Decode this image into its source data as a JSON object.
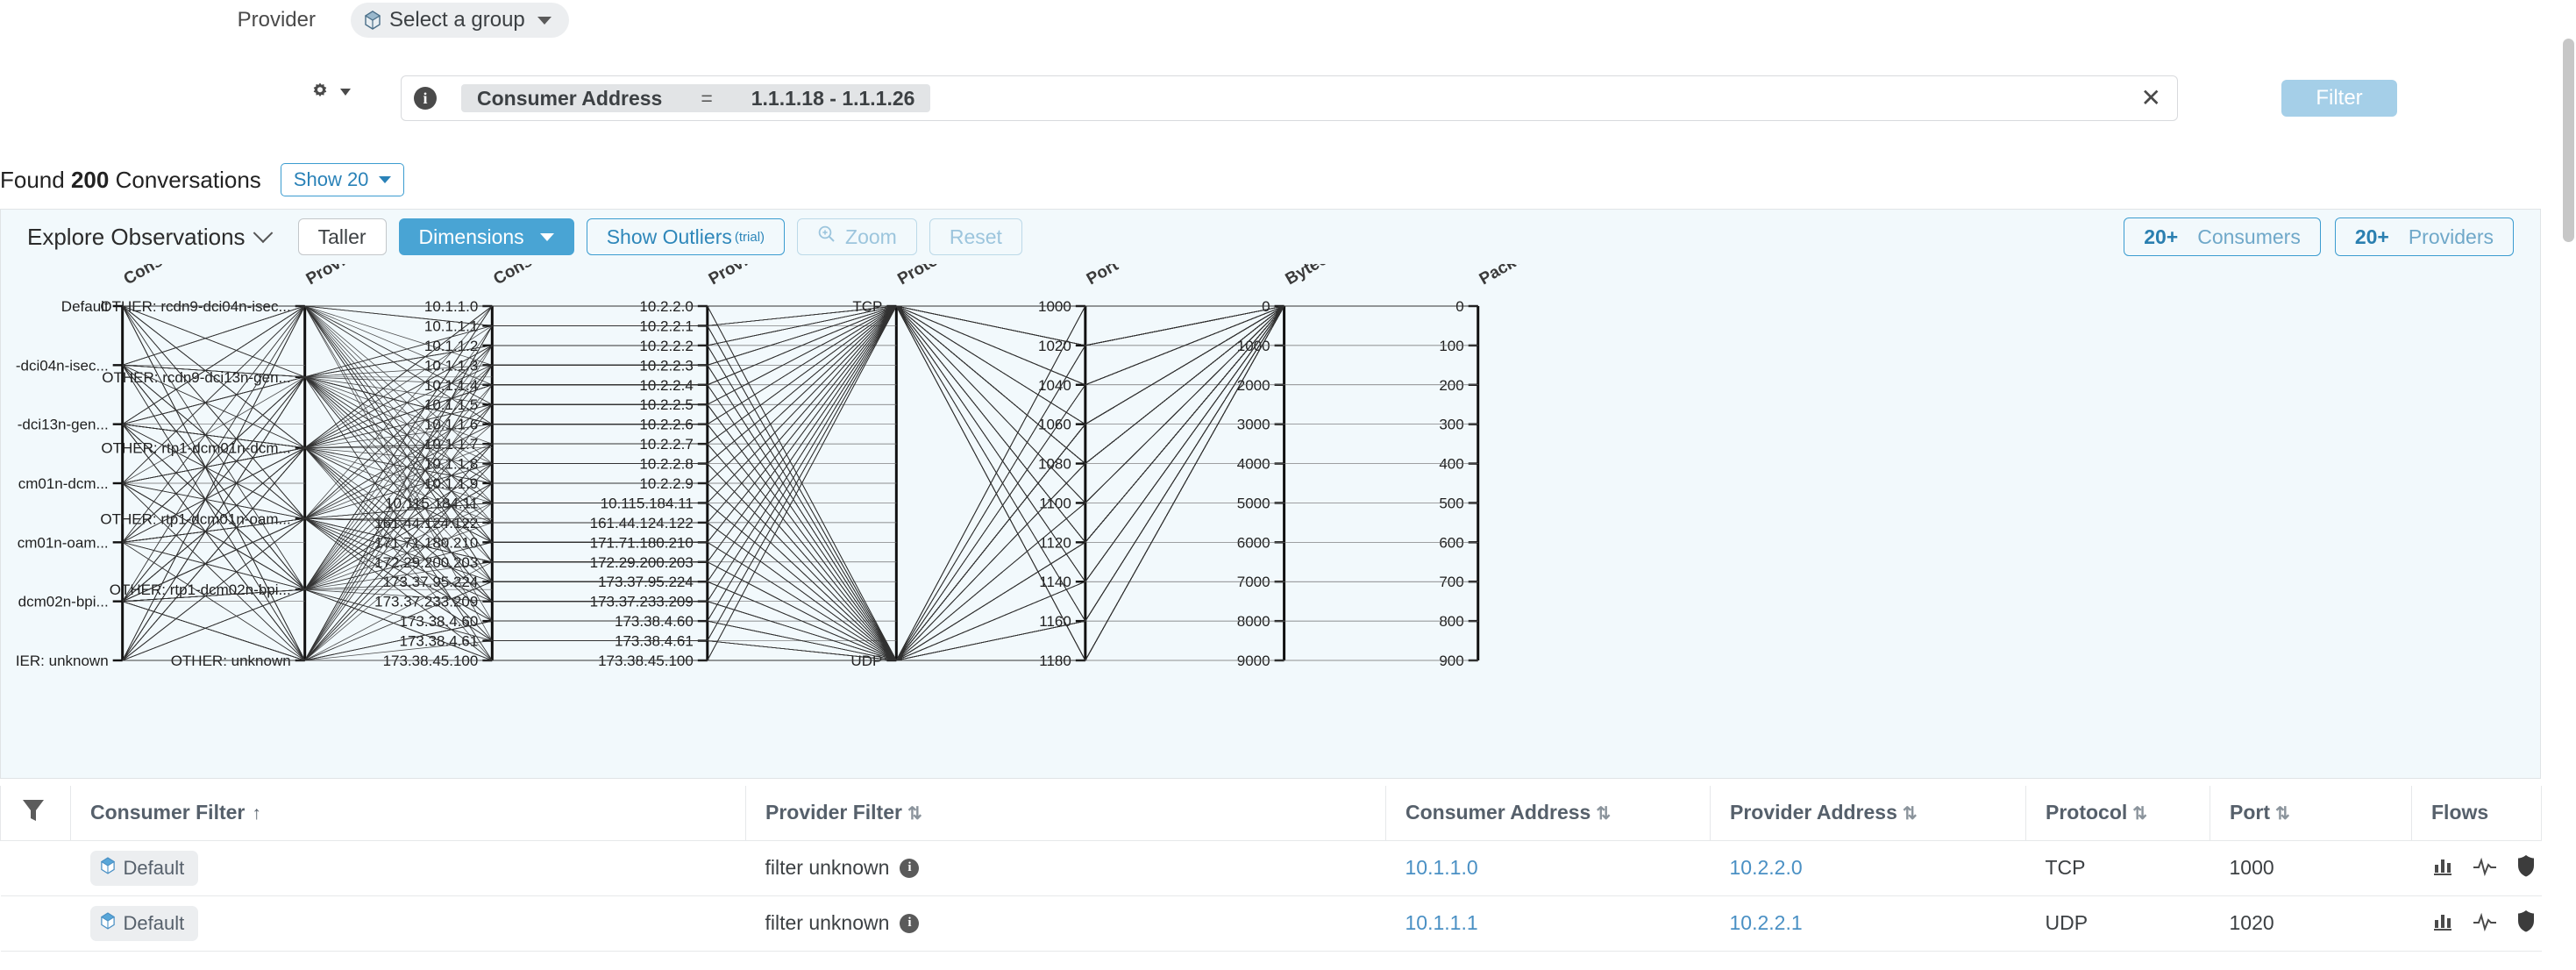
{
  "header": {
    "provider_label": "Provider",
    "group_select_label": "Select a group",
    "group_icon": "cube-icon",
    "caret_icon": "chevron-down-icon"
  },
  "filter_bar": {
    "gear_icon": "gear-icon",
    "info_icon": "info-icon",
    "token_field": "Consumer Address",
    "token_operator": "=",
    "token_value": "1.1.1.18 - 1.1.1.26",
    "clear_icon": "close-icon",
    "clear_glyph": "✕",
    "filter_button": "Filter"
  },
  "results": {
    "found_prefix": "Found",
    "found_count": "200",
    "found_suffix": "Conversations",
    "show_label": "Show 20"
  },
  "chart_toolbar": {
    "explore_label": "Explore Observations",
    "taller": "Taller",
    "dimensions": "Dimensions",
    "show_outliers": "Show Outliers",
    "show_outliers_sup": "(trial)",
    "zoom": "Zoom",
    "zoom_icon": "zoom-in-icon",
    "reset": "Reset",
    "consumers_count": "20+",
    "consumers_label": "Consumers",
    "providers_count": "20+",
    "providers_label": "Providers"
  },
  "chart_data": {
    "type": "parallel-coordinates",
    "title": "Explore Observations",
    "axes": [
      {
        "name": "Consumer Filter",
        "scale": "categorical",
        "ticks": [
          "Default",
          "-dci04n-isec...",
          "-dci13n-gen...",
          "cm01n-dcm...",
          "cm01n-oam...",
          "dcm02n-bpi...",
          "IER: unknown"
        ]
      },
      {
        "name": "Provider Filter",
        "scale": "categorical",
        "ticks": [
          "OTHER: rcdn9-dci04n-isec...",
          "OTHER: rcdn9-dci13n-gen...",
          "OTHER: rtp1-dcm01n-dcm...",
          "OTHER: rtp1-dcm01n-oam...",
          "OTHER: rtp1-dcm02n-bpi...",
          "OTHER: unknown"
        ]
      },
      {
        "name": "Consumer Address",
        "scale": "categorical",
        "ticks": [
          "10.1.1.0",
          "10.1.1.1",
          "10.1.1.2",
          "10.1.1.3",
          "10.1.1.4",
          "10.1.1.5",
          "10.1.1.6",
          "10.1.1.7",
          "10.1.1.8",
          "10.1.1.9",
          "10.115.184.11",
          "161.44.124.122",
          "171.71.180.210",
          "172.29.200.203",
          "173.37.95.224",
          "173.37.233.209",
          "173.38.4.60",
          "173.38.4.61",
          "173.38.45.100"
        ]
      },
      {
        "name": "Provider Address",
        "scale": "categorical",
        "ticks": [
          "10.2.2.0",
          "10.2.2.1",
          "10.2.2.2",
          "10.2.2.3",
          "10.2.2.4",
          "10.2.2.5",
          "10.2.2.6",
          "10.2.2.7",
          "10.2.2.8",
          "10.2.2.9",
          "10.115.184.11",
          "161.44.124.122",
          "171.71.180.210",
          "172.29.200.203",
          "173.37.95.224",
          "173.37.233.209",
          "173.38.4.60",
          "173.38.4.61",
          "173.38.45.100"
        ]
      },
      {
        "name": "Protocol",
        "scale": "categorical",
        "ticks": [
          "TCP",
          "UDP"
        ]
      },
      {
        "name": "Port",
        "scale": "numeric",
        "ticks": [
          "1000",
          "1020",
          "1040",
          "1060",
          "1080",
          "1100",
          "1120",
          "1140",
          "1160",
          "1180"
        ],
        "range": [
          1000,
          1180
        ]
      },
      {
        "name": "Bytecount",
        "scale": "numeric",
        "ticks": [
          "0",
          "1000",
          "2000",
          "3000",
          "4000",
          "5000",
          "6000",
          "7000",
          "8000",
          "9000"
        ],
        "range": [
          0,
          9000
        ]
      },
      {
        "name": "Packetcount",
        "scale": "numeric",
        "ticks": [
          "0",
          "100",
          "200",
          "300",
          "400",
          "500",
          "600",
          "700",
          "800",
          "900"
        ],
        "range": [
          0,
          900
        ]
      }
    ],
    "series_count": 200,
    "line_color": "#333333",
    "background": "#f2f9fc"
  },
  "table": {
    "filter_icon": "funnel-icon",
    "columns": [
      {
        "label": "Consumer Filter",
        "sort": "asc",
        "sort_glyph": "↑"
      },
      {
        "label": "Provider Filter",
        "sort": "none",
        "sort_glyph": "⇅"
      },
      {
        "label": "Consumer Address",
        "sort": "none",
        "sort_glyph": "⇅"
      },
      {
        "label": "Provider Address",
        "sort": "none",
        "sort_glyph": "⇅"
      },
      {
        "label": "Protocol",
        "sort": "none",
        "sort_glyph": "⇅"
      },
      {
        "label": "Port",
        "sort": "none",
        "sort_glyph": "⇅"
      },
      {
        "label": "Flows",
        "sort": null,
        "sort_glyph": ""
      }
    ],
    "rows": [
      {
        "consumer_filter": "Default",
        "provider_filter": "filter unknown",
        "consumer_address": "10.1.1.0",
        "provider_address": "10.2.2.0",
        "protocol": "TCP",
        "port": "1000",
        "flow_icons": [
          "bar-chart-icon",
          "pulse-icon",
          "shield-icon"
        ]
      },
      {
        "consumer_filter": "Default",
        "provider_filter": "filter unknown",
        "consumer_address": "10.1.1.1",
        "provider_address": "10.2.2.1",
        "protocol": "UDP",
        "port": "1020",
        "flow_icons": [
          "bar-chart-icon",
          "pulse-icon",
          "shield-icon"
        ]
      }
    ]
  },
  "colors": {
    "accent_blue": "#49a4d4",
    "link_blue": "#4a90c4",
    "panel_bg": "#f2f9fc",
    "chip_bg": "#eceef0"
  }
}
